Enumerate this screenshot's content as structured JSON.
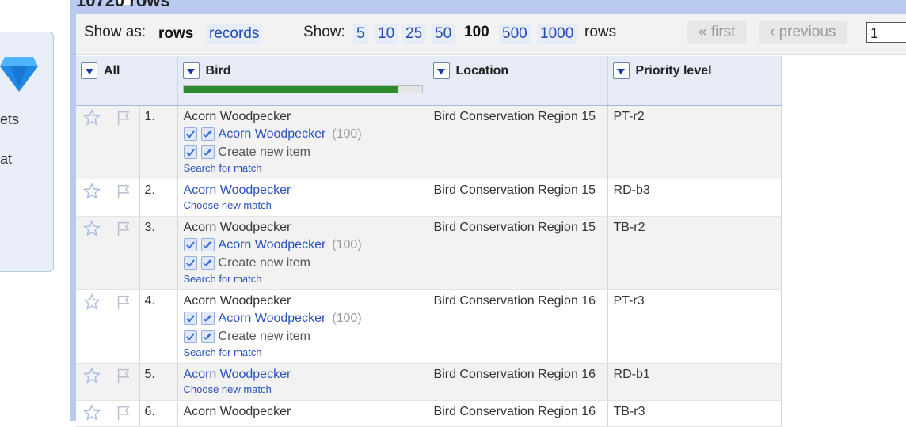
{
  "header": {
    "title": "10720 rows"
  },
  "left": {
    "item1": "ets",
    "item2": "at"
  },
  "controls": {
    "show_as_label": "Show as:",
    "rows_label": "rows",
    "records_label": "records",
    "show_label": "Show:",
    "page_sizes": [
      "5",
      "10",
      "25",
      "50",
      "100",
      "500",
      "1000"
    ],
    "active_size": "100",
    "rows_suffix": "rows",
    "first_label": "« first",
    "previous_label": "‹ previous",
    "page_value": "1"
  },
  "columns": {
    "all": "All",
    "bird": "Bird",
    "location": "Location",
    "priority": "Priority level",
    "bird_progress": 0.9
  },
  "rows": [
    {
      "num": "1.",
      "bird": "Acorn Woodpecker",
      "state": "candidates",
      "candidate": "Acorn Woodpecker",
      "score": "(100)",
      "create": "Create new item",
      "action": "Search for match",
      "location": "Bird Conservation Region 15",
      "priority": "PT-r2"
    },
    {
      "num": "2.",
      "bird": "Acorn Woodpecker",
      "state": "matched",
      "action": "Choose new match",
      "location": "Bird Conservation Region 15",
      "priority": "RD-b3"
    },
    {
      "num": "3.",
      "bird": "Acorn Woodpecker",
      "state": "candidates",
      "candidate": "Acorn Woodpecker",
      "score": "(100)",
      "create": "Create new item",
      "action": "Search for match",
      "location": "Bird Conservation Region 15",
      "priority": "TB-r2"
    },
    {
      "num": "4.",
      "bird": "Acorn Woodpecker",
      "state": "candidates",
      "candidate": "Acorn Woodpecker",
      "score": "(100)",
      "create": "Create new item",
      "action": "Search for match",
      "location": "Bird Conservation Region 16",
      "priority": "PT-r3"
    },
    {
      "num": "5.",
      "bird": "Acorn Woodpecker",
      "state": "matched",
      "action": "Choose new match",
      "location": "Bird Conservation Region 16",
      "priority": "RD-b1"
    },
    {
      "num": "6.",
      "bird": "Acorn Woodpecker",
      "state": "plain",
      "location": "Bird Conservation Region 16",
      "priority": "TB-r3"
    }
  ],
  "colors": {
    "accent": "#2a52be",
    "frame": "#b9c9f0",
    "progress": "#2e8b2e"
  }
}
